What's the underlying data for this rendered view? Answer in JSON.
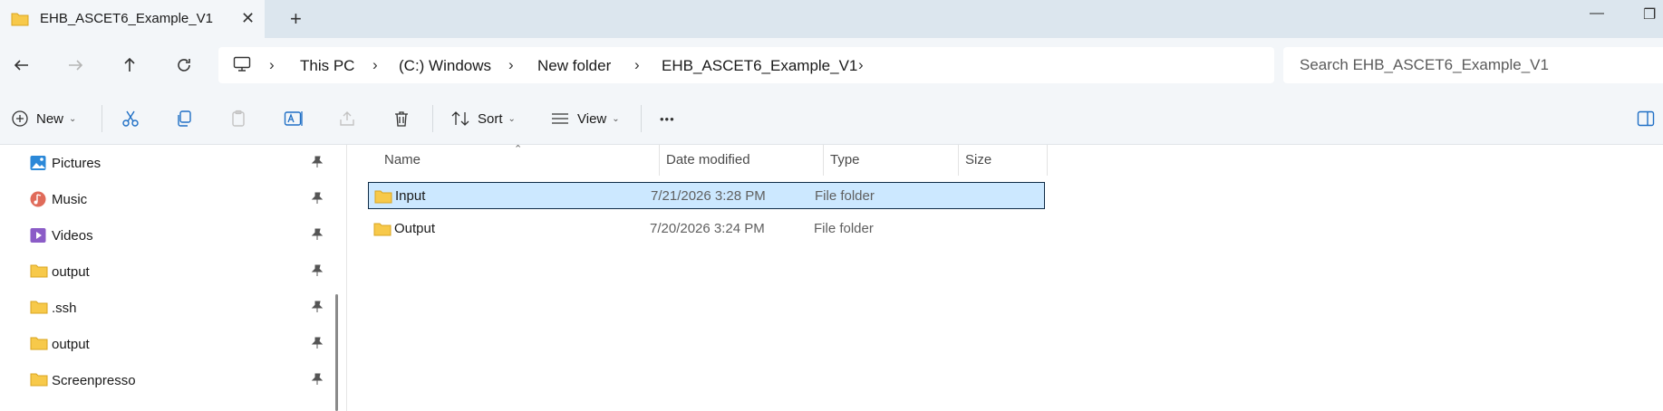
{
  "window": {
    "tab_title": "EHB_ASCET6_Example_V1",
    "close_glyph": "✕",
    "new_tab_glyph": "+",
    "minimize_glyph": "—",
    "restore_glyph": "❐"
  },
  "address": {
    "breadcrumbs": [
      "This PC",
      "(C:) Windows",
      "New folder",
      "EHB_ASCET6_Example_V1"
    ],
    "search_placeholder": "Search EHB_ASCET6_Example_V1"
  },
  "toolbar": {
    "new_label": "New",
    "sort_label": "Sort",
    "view_label": "View",
    "more_glyph": "•••"
  },
  "sidebar": {
    "items": [
      {
        "label": "Pictures",
        "icon": "pictures-icon"
      },
      {
        "label": "Music",
        "icon": "music-icon"
      },
      {
        "label": "Videos",
        "icon": "videos-icon"
      },
      {
        "label": "output",
        "icon": "folder-icon"
      },
      {
        "label": ".ssh",
        "icon": "folder-icon"
      },
      {
        "label": "output",
        "icon": "folder-icon"
      },
      {
        "label": "Screenpresso",
        "icon": "folder-icon"
      }
    ]
  },
  "file_list": {
    "columns": [
      "Name",
      "Date modified",
      "Type",
      "Size"
    ],
    "rows": [
      {
        "name": "Input",
        "date": "7/21/2026 3:28 PM",
        "type": "File folder",
        "size": "",
        "selected": true
      },
      {
        "name": "Output",
        "date": "7/20/2026 3:24 PM",
        "type": "File folder",
        "size": "",
        "selected": false
      }
    ]
  },
  "colors": {
    "selection": "#cce8ff",
    "folder": "#f7c94a",
    "chrome": "#f3f6f9"
  }
}
